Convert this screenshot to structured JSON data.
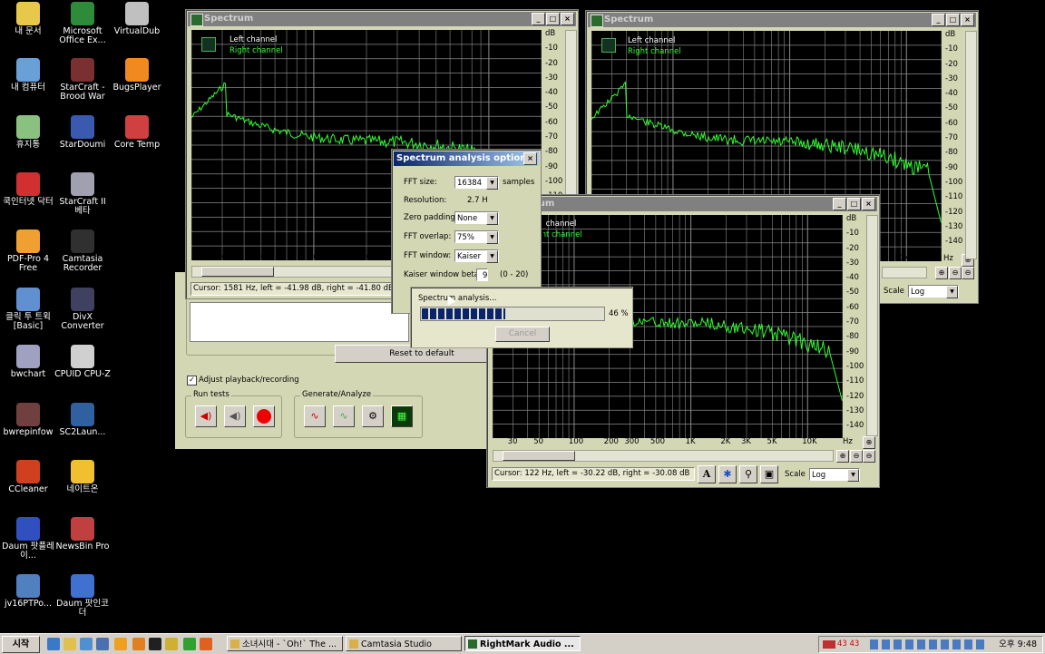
{
  "desktop_icons": [
    {
      "label": "내 문서",
      "color": "#e8c84a"
    },
    {
      "label": "Microsoft Office Ex...",
      "color": "#2e8b3a"
    },
    {
      "label": "VirtualDub",
      "color": "#c0c0c0"
    },
    {
      "label": "내 컴퓨터",
      "color": "#6aa0d8"
    },
    {
      "label": "StarCraft - Brood War",
      "color": "#7a3030"
    },
    {
      "label": "BugsPlayer",
      "color": "#f08a20"
    },
    {
      "label": "휴지통",
      "color": "#8ac080"
    },
    {
      "label": "StarDoumi",
      "color": "#3a5ab0"
    },
    {
      "label": "Core Temp",
      "color": "#d04040"
    },
    {
      "label": "쿡인터넷 닥터",
      "color": "#d03030"
    },
    {
      "label": "StarCraft II 베타",
      "color": "#a0a0b0"
    },
    {
      "label": "PDF-Pro 4 Free",
      "color": "#f0a030"
    },
    {
      "label": "Camtasia Recorder",
      "color": "#303030"
    },
    {
      "label": "클릭 투 트윅 [Basic]",
      "color": "#6090d0"
    },
    {
      "label": "DivX Converter",
      "color": "#404060"
    },
    {
      "label": "bwchart",
      "color": "#a0a0c0"
    },
    {
      "label": "CPUID CPU-Z",
      "color": "#d0d0d0"
    },
    {
      "label": "bwrepinfow",
      "color": "#704040"
    },
    {
      "label": "SC2Laun...",
      "color": "#3060a0"
    },
    {
      "label": "CCleaner",
      "color": "#d04020"
    },
    {
      "label": "네이트온",
      "color": "#f0c030"
    },
    {
      "label": "Daum 팟플레이...",
      "color": "#3050c0"
    },
    {
      "label": "NewsBin Pro",
      "color": "#c04040"
    },
    {
      "label": "jv16PTPo...",
      "color": "#5080c0"
    },
    {
      "label": "Daum 팟인코더",
      "color": "#4070d0"
    }
  ],
  "spectrum_left": {
    "title": "Spectrum",
    "legend_left": "Left channel",
    "legend_right": "Right channel",
    "db_unit": "dB",
    "db_ticks": [
      "-10",
      "-20",
      "-30",
      "-40",
      "-50",
      "-60",
      "-70",
      "-80",
      "-90",
      "-100",
      "-110"
    ],
    "x_ticks": [
      "30",
      "50",
      "100",
      "200",
      "300",
      "500"
    ],
    "status": "Cursor:  1581 Hz,  left = -41.98 dB,  right = -41.80 dB"
  },
  "spectrum_right": {
    "title": "Spectrum",
    "legend_left": "Left channel",
    "legend_right": "Right channel",
    "db_unit": "dB",
    "db_ticks": [
      "-10",
      "-20",
      "-30",
      "-40",
      "-50",
      "-60",
      "-70",
      "-80",
      "-90",
      "-100",
      "-110",
      "-120",
      "-130",
      "-140"
    ],
    "x_ticks": [
      "10K"
    ],
    "hz": "Hz",
    "scale_label": "Scale",
    "scale_value": "Log"
  },
  "spectrum_front": {
    "title": "Spectrum",
    "legend_left": "Left channel",
    "legend_right": "Right channel",
    "db_unit": "dB",
    "db_ticks": [
      "-10",
      "-20",
      "-30",
      "-40",
      "-50",
      "-60",
      "-70",
      "-80",
      "-90",
      "-100",
      "-110",
      "-120",
      "-130",
      "-140"
    ],
    "x_ticks": [
      "30",
      "50",
      "100",
      "200",
      "300",
      "500",
      "1K",
      "2K",
      "3K",
      "5K",
      "10K"
    ],
    "hz": "Hz",
    "status": "Cursor:  122 Hz,  left = -30.22 dB,  right = -30.08 dB",
    "scale_label": "Scale",
    "scale_value": "Log"
  },
  "options": {
    "title": "Spectrum analysis options",
    "fft_size_label": "FFT size:",
    "fft_size_value": "16384",
    "samples": "samples",
    "resolution_label": "Resolution:",
    "resolution_value": "2.7 H",
    "zero_padding_label": "Zero padding:",
    "zero_padding_value": "None",
    "fft_overlap_label": "FFT overlap:",
    "fft_overlap_value": "75%",
    "fft_window_label": "FFT window:",
    "fft_window_value": "Kaiser",
    "kaiser_label": "Kaiser window beta:",
    "kaiser_value": "9",
    "kaiser_range": "(0 - 20)",
    "reset": "Reset to default"
  },
  "progress": {
    "label": "Spectrum analysis...",
    "percent_text": "46 %",
    "percent": 0.46,
    "cancel": "Cancel"
  },
  "main_panel": {
    "adjust_label": "Adjust playback/recording",
    "run_tests": "Run tests",
    "generate_analyze": "Generate/Analyze"
  },
  "taskbar": {
    "start": "시작",
    "tasks": [
      {
        "label": "소녀시대 - `Oh!` The ..."
      },
      {
        "label": "Camtasia Studio"
      },
      {
        "label": "RightMark Audio ..."
      }
    ],
    "tray_numbers": "43  43",
    "clock": "오후 9:48"
  }
}
